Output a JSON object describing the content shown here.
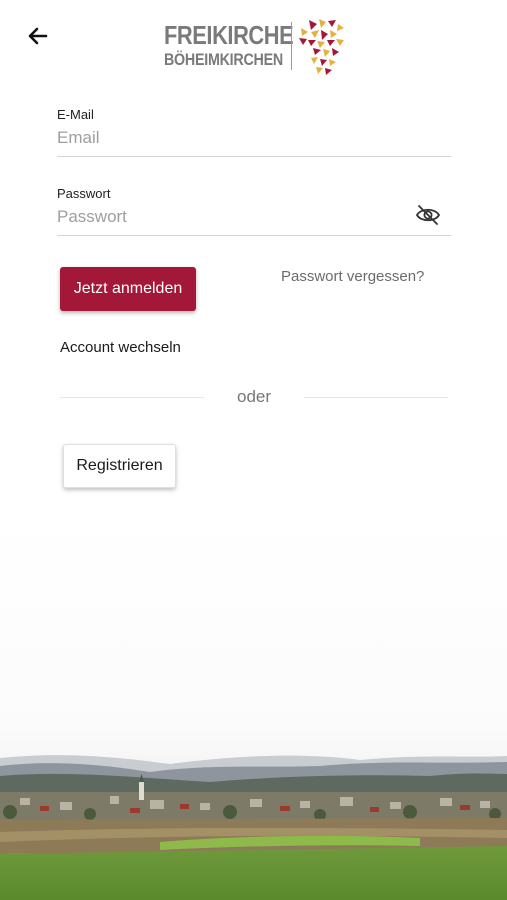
{
  "header": {
    "back_icon": "arrow-left-icon",
    "logo_line1": "FREIKIRCHE",
    "logo_line2": "BÖHEIMKIRCHEN"
  },
  "form": {
    "email_label": "E-Mail",
    "email_placeholder": "Email",
    "email_value": "",
    "password_label": "Passwort",
    "password_placeholder": "Passwort",
    "password_value": "",
    "password_toggle_icon": "eye-off-icon"
  },
  "actions": {
    "login_label": "Jetzt anmelden",
    "forgot_label": "Passwort vergessen?",
    "switch_account_label": "Account wechseln",
    "divider_label": "oder",
    "register_label": "Registrieren"
  },
  "colors": {
    "primary": "#a31839",
    "logo_gray": "#7a7a7a",
    "logo_gold": "#e3b23c",
    "logo_crimson": "#a31839"
  }
}
